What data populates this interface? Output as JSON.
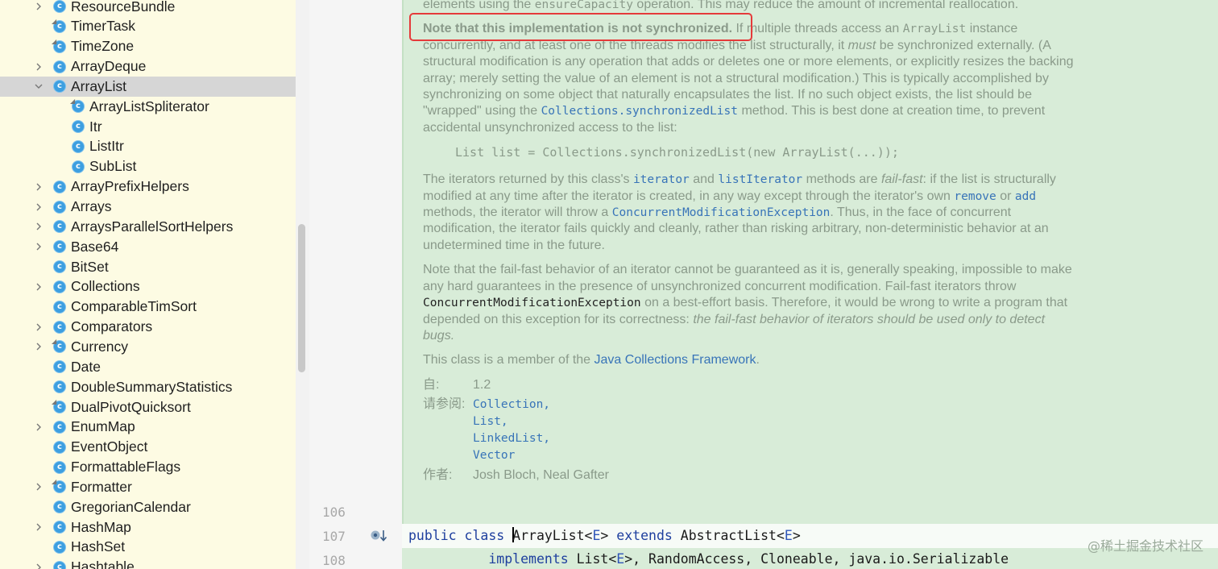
{
  "tree": {
    "items": [
      {
        "label": "ResourceBundle",
        "level": 1,
        "expandable": true,
        "selected": false,
        "icon": "class-icon"
      },
      {
        "label": "TimerTask",
        "level": 1,
        "expandable": false,
        "selected": false,
        "icon": "abstract-class-icon"
      },
      {
        "label": "TimeZone",
        "level": 1,
        "expandable": false,
        "selected": false,
        "icon": "abstract-class-icon"
      },
      {
        "label": "ArrayDeque",
        "level": 1,
        "expandable": true,
        "selected": false,
        "icon": "class-icon"
      },
      {
        "label": "ArrayList",
        "level": 1,
        "expandable": true,
        "expanded": true,
        "selected": true,
        "icon": "class-icon"
      },
      {
        "label": "ArrayListSpliterator",
        "level": 2,
        "expandable": false,
        "selected": false,
        "icon": "static-class-icon"
      },
      {
        "label": "Itr",
        "level": 2,
        "expandable": false,
        "selected": false,
        "icon": "class-icon"
      },
      {
        "label": "ListItr",
        "level": 2,
        "expandable": false,
        "selected": false,
        "icon": "class-icon"
      },
      {
        "label": "SubList",
        "level": 2,
        "expandable": false,
        "selected": false,
        "icon": "class-icon"
      },
      {
        "label": "ArrayPrefixHelpers",
        "level": 1,
        "expandable": true,
        "selected": false,
        "icon": "class-icon"
      },
      {
        "label": "Arrays",
        "level": 1,
        "expandable": true,
        "selected": false,
        "icon": "class-icon"
      },
      {
        "label": "ArraysParallelSortHelpers",
        "level": 1,
        "expandable": true,
        "selected": false,
        "icon": "class-icon"
      },
      {
        "label": "Base64",
        "level": 1,
        "expandable": true,
        "selected": false,
        "icon": "class-icon"
      },
      {
        "label": "BitSet",
        "level": 1,
        "expandable": false,
        "selected": false,
        "icon": "class-icon"
      },
      {
        "label": "Collections",
        "level": 1,
        "expandable": true,
        "selected": false,
        "icon": "class-icon"
      },
      {
        "label": "ComparableTimSort",
        "level": 1,
        "expandable": false,
        "selected": false,
        "icon": "class-icon"
      },
      {
        "label": "Comparators",
        "level": 1,
        "expandable": true,
        "selected": false,
        "icon": "class-icon"
      },
      {
        "label": "Currency",
        "level": 1,
        "expandable": true,
        "selected": false,
        "icon": "final-class-icon"
      },
      {
        "label": "Date",
        "level": 1,
        "expandable": false,
        "selected": false,
        "icon": "class-icon"
      },
      {
        "label": "DoubleSummaryStatistics",
        "level": 1,
        "expandable": false,
        "selected": false,
        "icon": "class-icon"
      },
      {
        "label": "DualPivotQuicksort",
        "level": 1,
        "expandable": false,
        "selected": false,
        "icon": "final-class-icon"
      },
      {
        "label": "EnumMap",
        "level": 1,
        "expandable": true,
        "selected": false,
        "icon": "class-icon"
      },
      {
        "label": "EventObject",
        "level": 1,
        "expandable": false,
        "selected": false,
        "icon": "class-icon"
      },
      {
        "label": "FormattableFlags",
        "level": 1,
        "expandable": false,
        "selected": false,
        "icon": "class-icon"
      },
      {
        "label": "Formatter",
        "level": 1,
        "expandable": true,
        "selected": false,
        "icon": "final-class-icon"
      },
      {
        "label": "GregorianCalendar",
        "level": 1,
        "expandable": false,
        "selected": false,
        "icon": "class-icon"
      },
      {
        "label": "HashMap",
        "level": 1,
        "expandable": true,
        "selected": false,
        "icon": "class-icon"
      },
      {
        "label": "HashSet",
        "level": 1,
        "expandable": false,
        "selected": false,
        "icon": "class-icon"
      },
      {
        "label": "Hashtable",
        "level": 1,
        "expandable": true,
        "selected": false,
        "icon": "class-icon"
      }
    ]
  },
  "doc": {
    "p0_pre": "elements using the ",
    "p0_code": "ensureCapacity",
    "p0_post": " operation. This may reduce the amount of incremental reallocation.",
    "p1_bold": "Note that this implementation is not synchronized.",
    "p1_a": " If multiple threads access an ",
    "p1_code1": "ArrayList",
    "p1_b": " instance concurrently, and at least one of the threads modifies the list structurally, it ",
    "p1_ital": "must",
    "p1_c": " be synchronized externally. (A structural modification is any operation that adds or deletes one or more elements, or explicitly resizes the backing array; merely setting the value of an element is not a structural modification.) This is typically accomplished by synchronizing on some object that naturally encapsulates the list. If no such object exists, the list should be \"wrapped\" using the ",
    "p1_link": "Collections.synchronizedList",
    "p1_d": " method. This is best done at creation time, to prevent accidental unsynchronized access to the list:",
    "code_sample": "List list = Collections.synchronizedList(new ArrayList(...));",
    "p2_a": "The iterators returned by this class's ",
    "p2_link1": "iterator",
    "p2_b": " and ",
    "p2_link2": "listIterator",
    "p2_c": " methods are ",
    "p2_ital": "fail-fast",
    "p2_d": ": if the list is structurally modified at any time after the iterator is created, in any way except through the iterator's own ",
    "p2_link3": "remove",
    "p2_e": " or ",
    "p2_link4": "add",
    "p2_f": " methods, the iterator will throw a ",
    "p2_link5": "ConcurrentModificationException",
    "p2_g": ". Thus, in the face of concurrent modification, the iterator fails quickly and cleanly, rather than risking arbitrary, non-deterministic behavior at an undetermined time in the future.",
    "p3_a": "Note that the fail-fast behavior of an iterator cannot be guaranteed as it is, generally speaking, impossible to make any hard guarantees in the presence of unsynchronized concurrent modification. Fail-fast iterators throw ",
    "p3_code": "ConcurrentModificationException",
    "p3_b": " on a best-effort basis. Therefore, it would be wrong to write a program that depended on this exception for its correctness: ",
    "p3_ital": "the fail-fast behavior of iterators should be used only to detect bugs.",
    "p4_a": "This class is a member of the ",
    "p4_link": "Java Collections Framework",
    "p4_b": ".",
    "since_key": "自:",
    "since_val": "1.2",
    "see_key": "请参阅:",
    "see_items": [
      "Collection,",
      "List,",
      "LinkedList,",
      "Vector"
    ],
    "author_key": "作者:",
    "author_val": "Josh Bloch, Neal Gafter"
  },
  "code": {
    "line_numbers": [
      "106",
      "107",
      "108"
    ],
    "l107_kw1": "public class ",
    "l107_name": "ArrayList",
    "l107_a": "<",
    "l107_t1": "E",
    "l107_b": "> ",
    "l107_kw2": "extends",
    "l107_c": " AbstractList<",
    "l107_t2": "E",
    "l107_d": ">",
    "l108_indent": "          ",
    "l108_kw": "implements",
    "l108_a": " List<",
    "l108_t": "E",
    "l108_b": ">, RandomAccess, Cloneable, java.io.Serializable"
  },
  "gutter_icon": "override-down-arrow-icon",
  "watermark": "@稀土掘金技术社区",
  "colors": {
    "highlight_box": "#e53a3a",
    "doc_background": "#d8ecd8",
    "tree_background": "#fdfbe3",
    "link": "#3874b8",
    "keyword": "#1e3f9e"
  }
}
